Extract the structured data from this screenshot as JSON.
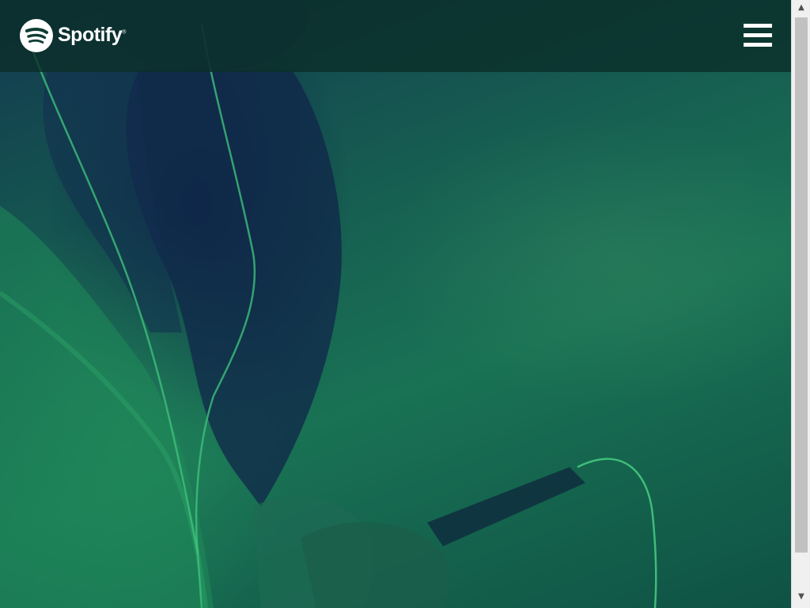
{
  "header": {
    "brand": "Spotify",
    "brand_mark": "®",
    "logo_icon": "spotify-logo-icon",
    "menu_icon": "hamburger-menu-icon"
  },
  "hero": {
    "image_description_icon": "woman-with-earphones-and-phone-photo",
    "tint_color": "#1a7a55"
  },
  "scrollbar": {
    "up_arrow": "▲",
    "down_arrow": "▼"
  }
}
